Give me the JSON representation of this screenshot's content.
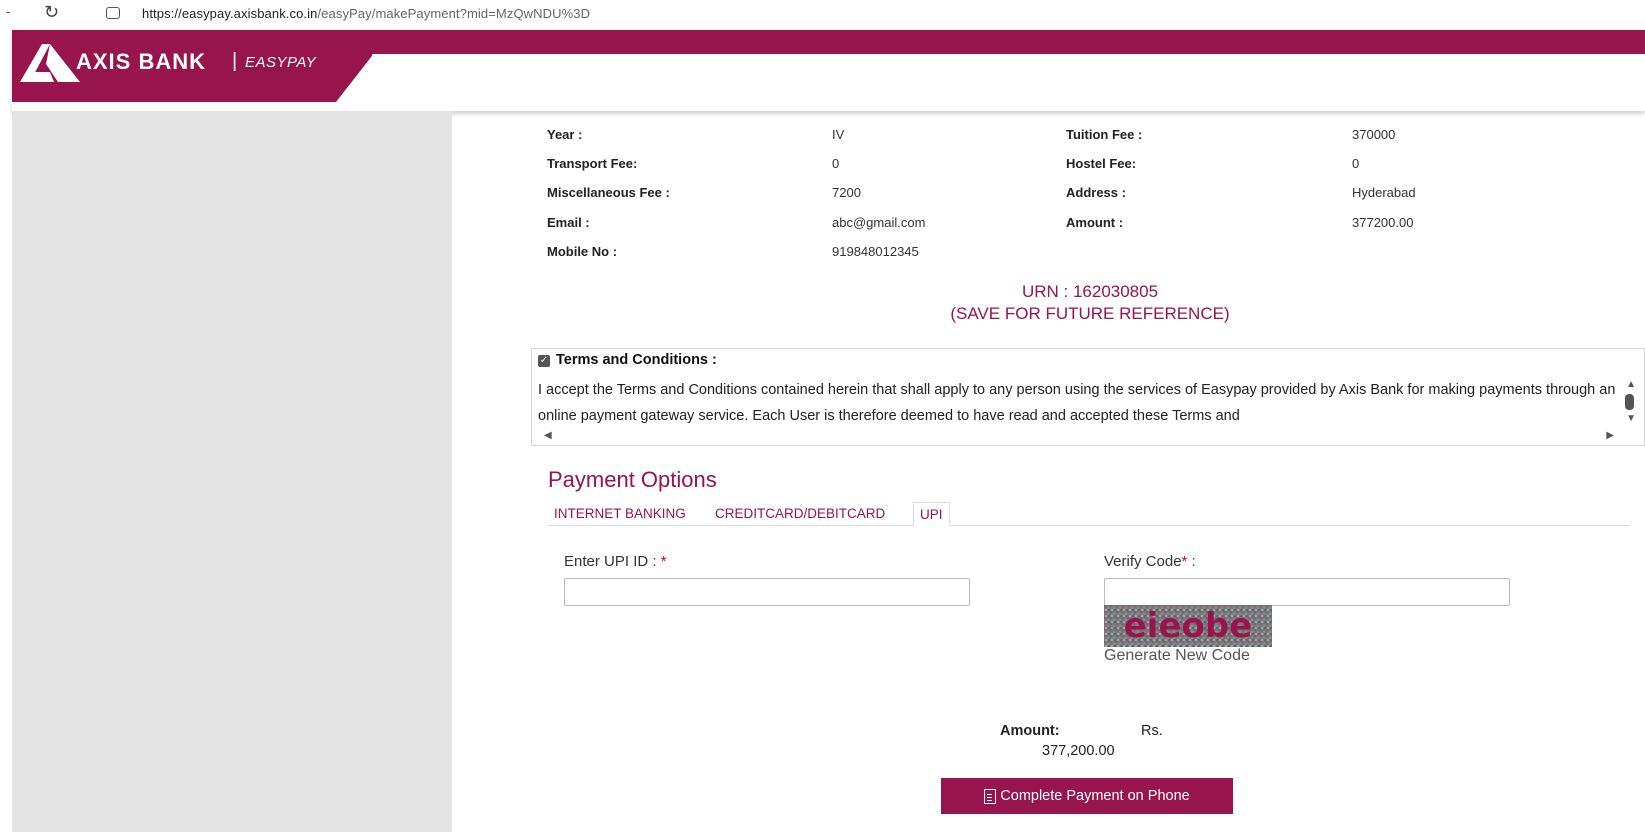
{
  "browser": {
    "url_host": "https://easypay.axisbank.co.in",
    "url_path": "/easyPay/makePayment?mid=MzQwNDU%3D"
  },
  "header": {
    "brand_name": "AXIS BANK",
    "separator": "|",
    "brand_sub": "EASYPAY",
    "brand_color": "#97144d"
  },
  "details": [
    {
      "label": "Year :",
      "value": "IV"
    },
    {
      "label": "Tuition Fee :",
      "value": "370000"
    },
    {
      "label": "Transport Fee:",
      "value": "0"
    },
    {
      "label": "Hostel Fee:",
      "value": "0"
    },
    {
      "label": "Miscellaneous Fee :",
      "value": "7200"
    },
    {
      "label": "Address :",
      "value": "Hyderabad"
    },
    {
      "label": "Email :",
      "value": "abc@gmail.com"
    },
    {
      "label": "Amount :",
      "value": "377200.00"
    },
    {
      "label": "Mobile No :",
      "value": "919848012345"
    }
  ],
  "urn": {
    "line1": "URN : 162030805",
    "line2": "(SAVE FOR FUTURE REFERENCE)"
  },
  "terms": {
    "title": "Terms and Conditions :",
    "checked": true,
    "text": "I accept the Terms and Conditions contained herein that shall apply to any person using the services of Easypay provided by Axis Bank for making payments through an online payment gateway service. Each User is therefore deemed to have read and accepted these Terms and"
  },
  "payment": {
    "title": "Payment Options",
    "tabs": [
      {
        "label": "INTERNET BANKING",
        "active": false
      },
      {
        "label": "CREDITCARD/DEBITCARD",
        "active": false
      },
      {
        "label": "UPI",
        "active": true
      }
    ],
    "upi_label": "Enter UPI ID : ",
    "upi_value": "",
    "verify_label": "Verify Code",
    "verify_suffix": " :",
    "required_mark": "*",
    "verify_value": "",
    "captcha_text": "eieobe",
    "generate_label": "Generate New Code",
    "amount_label": "Amount:",
    "amount_currency": "Rs.",
    "amount_value": "377,200.00",
    "submit_label": "Complete Payment on Phone"
  }
}
